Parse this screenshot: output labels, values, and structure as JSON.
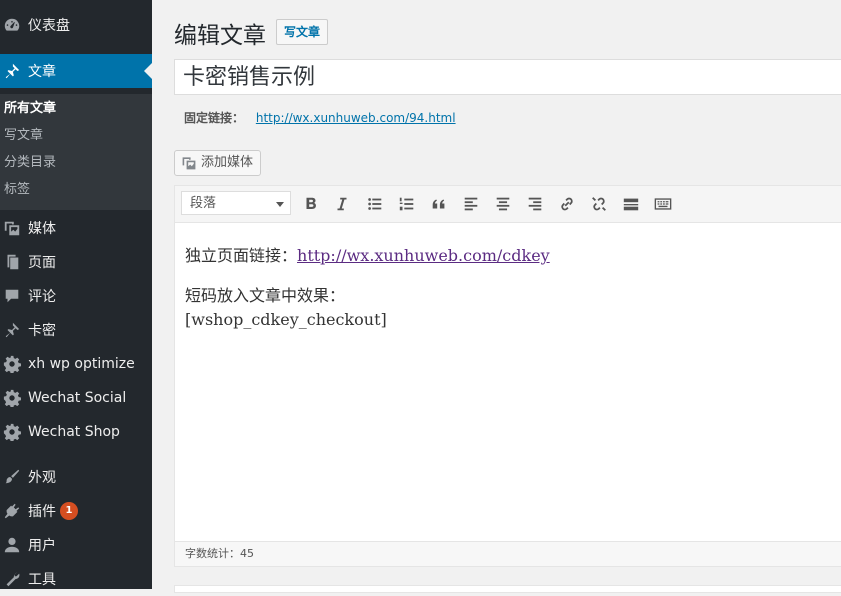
{
  "sidebar": {
    "items": [
      {
        "key": "dashboard",
        "label": "仪表盘",
        "icon": "dashboard-icon"
      },
      {
        "key": "posts",
        "label": "文章",
        "icon": "pushpin-icon"
      },
      {
        "key": "media",
        "label": "媒体",
        "icon": "media-icon"
      },
      {
        "key": "pages",
        "label": "页面",
        "icon": "page-icon"
      },
      {
        "key": "comments",
        "label": "评论",
        "icon": "comment-icon"
      },
      {
        "key": "cards",
        "label": "卡密",
        "icon": "pushpin-icon"
      },
      {
        "key": "xh-optimize",
        "label": "xh wp optimize",
        "icon": "gear-icon"
      },
      {
        "key": "wechat-social",
        "label": "Wechat Social",
        "icon": "gear-icon"
      },
      {
        "key": "wechat-shop",
        "label": "Wechat Shop",
        "icon": "gear-icon"
      },
      {
        "key": "appearance",
        "label": "外观",
        "icon": "brush-icon"
      },
      {
        "key": "plugins",
        "label": "插件",
        "icon": "plug-icon",
        "badge": "1"
      },
      {
        "key": "users",
        "label": "用户",
        "icon": "user-icon"
      },
      {
        "key": "tools",
        "label": "工具",
        "icon": "wrench-icon"
      }
    ],
    "submenu": [
      "所有文章",
      "写文章",
      "分类目录",
      "标签"
    ]
  },
  "header": {
    "title": "编辑文章",
    "add_new": "写文章"
  },
  "post": {
    "title": "卡密销售示例",
    "permalink_label": "固定链接：",
    "permalink_url": "http://wx.xunhuweb.com/94.html"
  },
  "media_button": "添加媒体",
  "editor": {
    "format": "段落",
    "line1_prefix": "独立页面链接：",
    "line1_link": "http://wx.xunhuweb.com/cdkey",
    "line2": "短码放入文章中效果：",
    "line3": "[wshop_cdkey_checkout]",
    "word_count": "字数统计：45"
  },
  "colors": {
    "sidebar_bg": "#23282d",
    "active_bg": "#0073aa",
    "submenu_bg": "#32373c",
    "link": "#0073aa",
    "badge": "#d54e21"
  }
}
